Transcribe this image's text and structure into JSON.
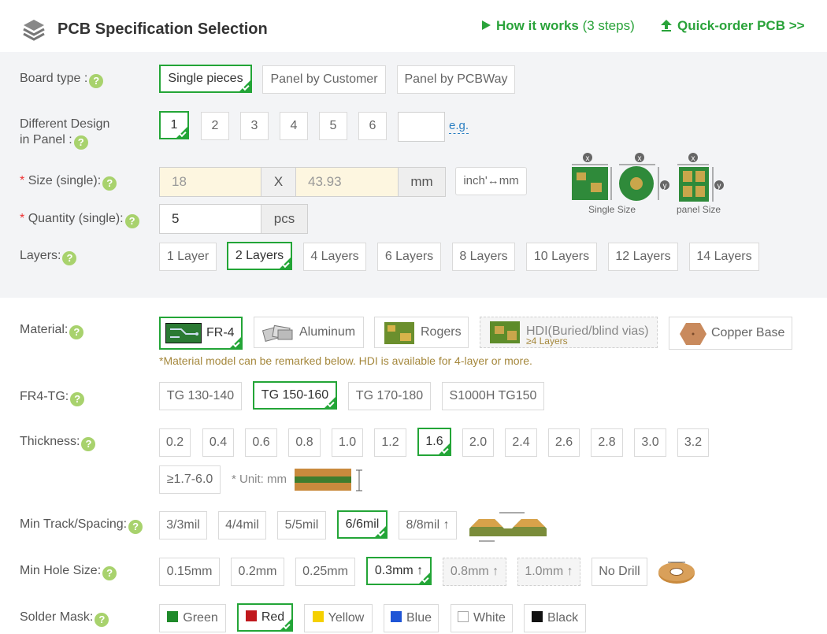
{
  "header": {
    "title": "PCB Specification Selection",
    "how_it_works": "How it works",
    "how_steps": "(3 steps)",
    "quick_order": "Quick-order PCB >>"
  },
  "board_type": {
    "label": "Board type :",
    "options": [
      "Single pieces",
      "Panel by Customer",
      "Panel by PCBWay"
    ],
    "selected": "Single pieces"
  },
  "different_design": {
    "label_line1": "Different Design",
    "label_line2": "in Panel :",
    "options": [
      "1",
      "2",
      "3",
      "4",
      "5",
      "6"
    ],
    "selected": "1",
    "custom_value": "",
    "eg": "e.g."
  },
  "size": {
    "required": "*",
    "label": "Size (single):",
    "x_value": "18",
    "y_value": "43.93",
    "separator": "X",
    "unit": "mm",
    "convert_button": "inch'↔mm"
  },
  "quantity": {
    "required": "*",
    "label": "Quantity (single):",
    "value": "5",
    "unit": "pcs"
  },
  "size_illustration": {
    "single_caption": "Single Size",
    "panel_caption": "panel Size",
    "x_mark": "X",
    "y_mark": "Y"
  },
  "layers": {
    "label": "Layers:",
    "options": [
      "1 Layer",
      "2 Layers",
      "4 Layers",
      "6 Layers",
      "8 Layers",
      "10 Layers",
      "12 Layers",
      "14 Layers"
    ],
    "selected": "2 Layers"
  },
  "material": {
    "label": "Material:",
    "options": [
      "FR-4",
      "Aluminum",
      "Rogers",
      "HDI(Buried/blind vias)",
      "Copper Base"
    ],
    "hdi_sub": "≥4 Layers",
    "selected": "FR-4",
    "note": "*Material model can be remarked below. HDI is available for 4-layer or more."
  },
  "fr4_tg": {
    "label": "FR4-TG:",
    "options": [
      "TG 130-140",
      "TG 150-160",
      "TG 170-180",
      "S1000H TG150"
    ],
    "selected": "TG 150-160"
  },
  "thickness": {
    "label": "Thickness:",
    "options": [
      "0.2",
      "0.4",
      "0.6",
      "0.8",
      "1.0",
      "1.2",
      "1.6",
      "2.0",
      "2.4",
      "2.6",
      "2.8",
      "3.0",
      "3.2",
      "≥1.7-6.0"
    ],
    "selected": "1.6",
    "unit_note": "* Unit: mm"
  },
  "min_track": {
    "label": "Min Track/Spacing:",
    "options": [
      "3/3mil",
      "4/4mil",
      "5/5mil",
      "6/6mil",
      "8/8mil ↑"
    ],
    "selected": "6/6mil"
  },
  "min_hole": {
    "label": "Min Hole Size:",
    "options": [
      "0.15mm",
      "0.2mm",
      "0.25mm",
      "0.3mm ↑",
      "0.8mm ↑",
      "1.0mm ↑",
      "No Drill"
    ],
    "selected": "0.3mm ↑"
  },
  "solder_mask": {
    "label": "Solder Mask:",
    "options": [
      "Green",
      "Red",
      "Yellow",
      "Blue",
      "White",
      "Black"
    ],
    "colors": [
      "#1f8a2a",
      "#c0181d",
      "#f5d000",
      "#1f55d6",
      "#ffffff",
      "#111111"
    ],
    "selected": "Red"
  },
  "colors": {
    "accent": "#23a537",
    "band": "#f3f4f6",
    "note": "#a5883d",
    "link": "#2a7ec2"
  }
}
